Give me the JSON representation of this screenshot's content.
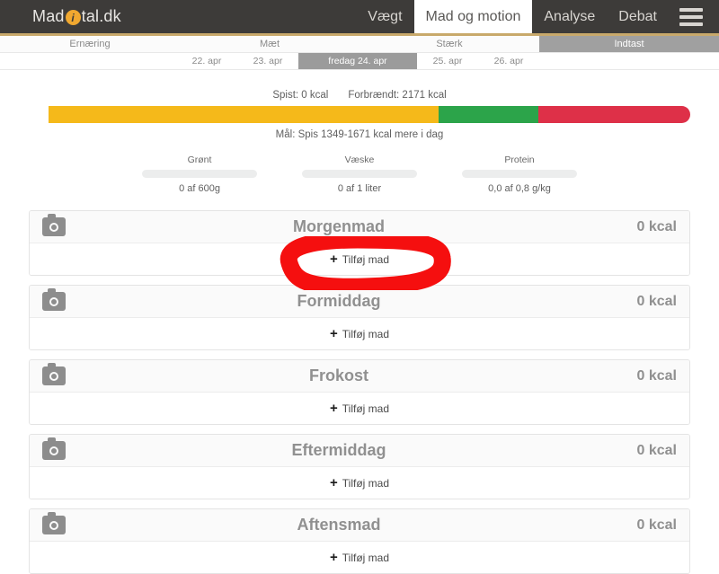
{
  "header": {
    "logo": {
      "prefix": "Mad",
      "dot": "i",
      "suffix": "tal.dk"
    },
    "nav": [
      {
        "label": "Vægt",
        "active": false
      },
      {
        "label": "Mad og motion",
        "active": true
      },
      {
        "label": "Analyse",
        "active": false
      },
      {
        "label": "Debat",
        "active": false
      }
    ],
    "menu_icon": "hamburger-icon"
  },
  "subnav": {
    "items": [
      {
        "label": "Ernæring",
        "active": false
      },
      {
        "label": "Mæt",
        "active": false
      },
      {
        "label": "Stærk",
        "active": false
      },
      {
        "label": "Indtast",
        "active": true
      }
    ]
  },
  "dates": {
    "items": [
      {
        "label": "22. apr",
        "selected": false
      },
      {
        "label": "23. apr",
        "selected": false
      },
      {
        "label": "fredag 24. apr",
        "selected": true
      },
      {
        "label": "25. apr",
        "selected": false
      },
      {
        "label": "26. apr",
        "selected": false
      }
    ]
  },
  "summary": {
    "eaten_label": "Spist: 0 kcal",
    "burned_label": "Forbrændt: 2171 kcal",
    "goal_label": "Mål: Spis 1349-1671 kcal mere i dag",
    "bar": {
      "segments": [
        {
          "name": "empty",
          "color": "#ffffff",
          "percent": 3
        },
        {
          "name": "yellow",
          "color": "#f5b91a",
          "percent": 59
        },
        {
          "name": "green",
          "color": "#2ca44a",
          "percent": 15
        },
        {
          "name": "red",
          "color": "#de3048",
          "percent": 23
        }
      ]
    }
  },
  "nutrients": [
    {
      "label": "Grønt",
      "value": "0 af 600g",
      "progress": 0
    },
    {
      "label": "Væske",
      "value": "0 af 1 liter",
      "progress": 0
    },
    {
      "label": "Protein",
      "value": "0,0 af 0,8 g/kg",
      "progress": 0
    }
  ],
  "meals": [
    {
      "title": "Morgenmad",
      "kcal": "0 kcal",
      "add_label": "Tilføj mad",
      "annotated": true
    },
    {
      "title": "Formiddag",
      "kcal": "0 kcal",
      "add_label": "Tilføj mad",
      "annotated": false
    },
    {
      "title": "Frokost",
      "kcal": "0 kcal",
      "add_label": "Tilføj mad",
      "annotated": false
    },
    {
      "title": "Eftermiddag",
      "kcal": "0 kcal",
      "add_label": "Tilføj mad",
      "annotated": false
    },
    {
      "title": "Aftensmad",
      "kcal": "0 kcal",
      "add_label": "Tilføj mad",
      "annotated": false
    }
  ],
  "annotation": {
    "shape": "red-oval-highlight",
    "color": "#f50f0f"
  },
  "colors": {
    "header_bg": "#3d3b39",
    "header_accent": "#c8a96b",
    "active_tab_bg": "#a0a0a0",
    "brand_orange": "#f0a830"
  }
}
